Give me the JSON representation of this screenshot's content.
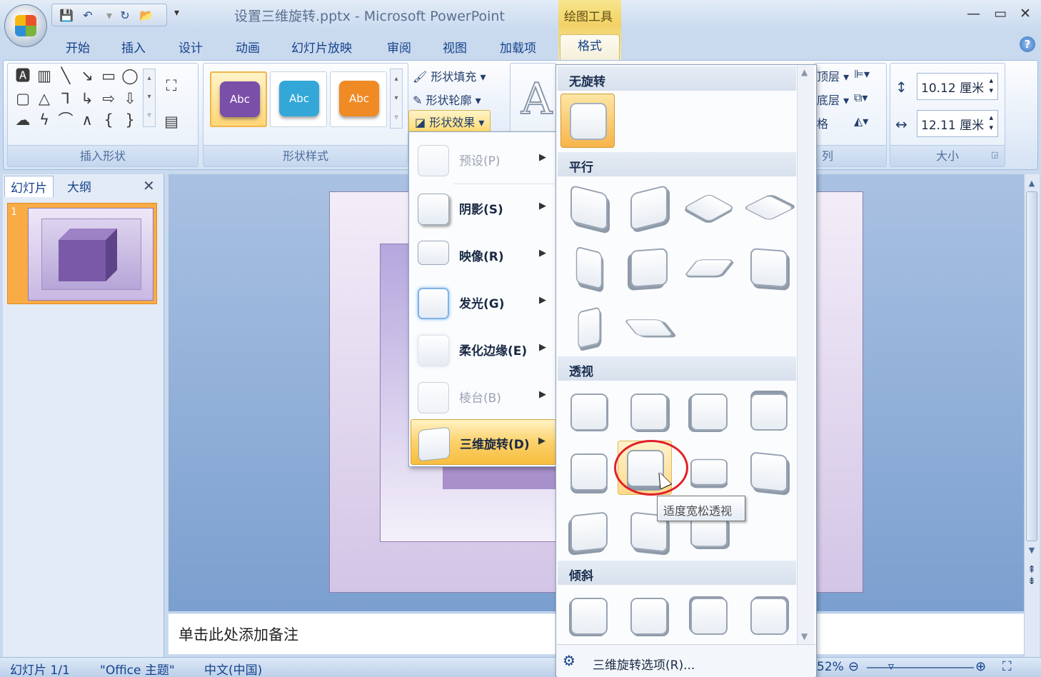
{
  "title_bar": {
    "window_title": "设置三维旋转.pptx - Microsoft PowerPoint",
    "context_tool_title": "绘图工具"
  },
  "tabs": [
    "开始",
    "插入",
    "设计",
    "动画",
    "幻灯片放映",
    "审阅",
    "视图",
    "加载项",
    "格式"
  ],
  "active_tab": "格式",
  "ribbon": {
    "insert_shapes_label": "插入形状",
    "shape_styles_label": "形状样式",
    "style_sample_text": "Abc",
    "style_colors": [
      "#7a4fa8",
      "#33a7d8",
      "#f08a24"
    ],
    "shape_fill": "形状填充",
    "shape_outline": "形状轮廓",
    "shape_effects": "形状效果",
    "wordart_glyph": "A",
    "arrange_partial_1": "顶层",
    "arrange_partial_2": "底层",
    "arrange_partial_3": "格",
    "arrange_label_partial": "列",
    "height_value": "10.12 厘米",
    "width_value": "12.11 厘米",
    "size_label": "大小"
  },
  "slides_panel": {
    "tab_slides": "幻灯片",
    "tab_outline": "大纲",
    "slide_number": "1"
  },
  "notes_placeholder": "单击此处添加备注",
  "effects_menu": {
    "items": [
      {
        "label": "预设(P)",
        "disabled": true
      },
      {
        "label": "阴影(S)",
        "disabled": false
      },
      {
        "label": "映像(R)",
        "disabled": false
      },
      {
        "label": "发光(G)",
        "disabled": false
      },
      {
        "label": "柔化边缘(E)",
        "disabled": false
      },
      {
        "label": "棱台(B)",
        "disabled": true
      },
      {
        "label": "三维旋转(D)",
        "disabled": false,
        "highlighted": true
      }
    ]
  },
  "rotation_gallery": {
    "section_none": "无旋转",
    "section_parallel": "平行",
    "section_perspective": "透视",
    "section_oblique": "倾斜",
    "footer_option": "三维旋转选项(R)...",
    "tooltip": "适度宽松透视"
  },
  "status_bar": {
    "slide_info": "幻灯片 1/1",
    "theme": "\"Office 主题\"",
    "language": "中文(中国)",
    "zoom_partial": "52%"
  }
}
